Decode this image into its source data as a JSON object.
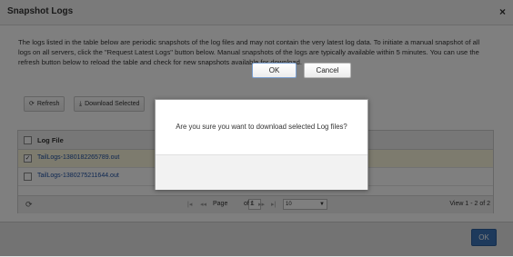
{
  "window": {
    "title": "Snapshot Logs",
    "close_glyph": "×",
    "intro": "The logs listed in the table below are periodic snapshots of the log files and may not contain the very latest log data. To initiate a manual snapshot of all logs on all servers, click the \"Request Latest Logs\" button below. Manual snapshots of the logs are typically available within 5 minutes. You can use the refresh button below to reload the table and check for new snapshots available for download."
  },
  "toolbar": {
    "refresh_label": "Refresh",
    "download_label": "Download Selected",
    "refresh_icon": "refresh-icon",
    "download_icon": "download-icon"
  },
  "table": {
    "column": "Log File",
    "rows": [
      {
        "file": "TailLogs-1380182265789.out",
        "checked": true
      },
      {
        "file": "TailLogs-1380275211644.out",
        "checked": false
      }
    ],
    "pager": {
      "page_label": "Page",
      "page_value": "1",
      "of_label": "of 1",
      "rows_per_page": "10",
      "view_text": "View 1 - 2 of 2"
    }
  },
  "footer": {
    "ok_label": "OK"
  },
  "dialog": {
    "message": "Are you sure you want to download selected Log files?",
    "ok_label": "OK",
    "cancel_label": "Cancel"
  },
  "colors": {
    "primary_button": "#3c75b9",
    "selected_row": "#fbf6dc",
    "link": "#1c4fa3"
  }
}
